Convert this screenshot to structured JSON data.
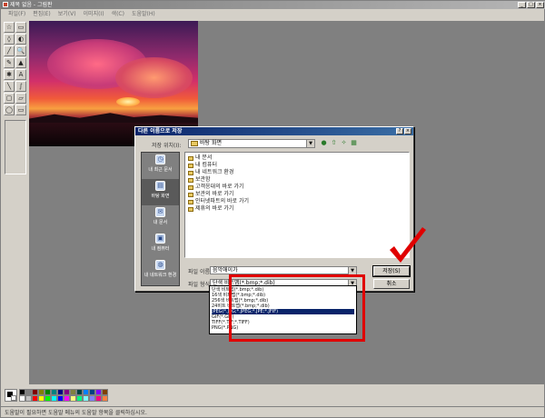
{
  "window": {
    "title": "제목 없음 - 그림판",
    "buttons": [
      "_",
      "□",
      "×"
    ]
  },
  "menu": [
    "파일(F)",
    "편집(E)",
    "보기(V)",
    "이미지(I)",
    "색(C)",
    "도움말(H)"
  ],
  "toolbox": {
    "tools": [
      "☆",
      "▭",
      "◊",
      "◐",
      "╱",
      "🔍",
      "✎",
      "▲",
      "✱",
      "A",
      "╲",
      "∫",
      "▢",
      "▱",
      "◯",
      "▭"
    ]
  },
  "palette": {
    "colors": [
      "#000000",
      "#808080",
      "#800000",
      "#808000",
      "#008000",
      "#008080",
      "#000080",
      "#800080",
      "#808040",
      "#004040",
      "#0080ff",
      "#004080",
      "#8000ff",
      "#804000",
      "#ffffff",
      "#c0c0c0",
      "#ff0000",
      "#ffff00",
      "#00ff00",
      "#00ffff",
      "#0000ff",
      "#ff00ff",
      "#ffff80",
      "#00ff80",
      "#80ffff",
      "#8080ff",
      "#ff0080",
      "#ff8040"
    ]
  },
  "status": "도움말이 필요하면 도움말 메뉴의 도움말 항목을 클릭하십시오.",
  "dialog": {
    "title": "다른 이름으로 저장",
    "close": "×",
    "help": "?",
    "look_in_label": "저장 위치(I):",
    "look_in_value": "바탕 화면",
    "nav_icons": [
      "●",
      "⇧",
      "✧",
      "▦"
    ],
    "places": [
      "내 최근 문서",
      "바탕 화면",
      "내 문서",
      "내 컴퓨터",
      "내 네트워크 환경"
    ],
    "places_icons": [
      "◷",
      "▤",
      "✉",
      "▣",
      "◍"
    ],
    "files": [
      "내 문서",
      "내 컴퓨터",
      "내 네트워크 환경",
      "보관함",
      "고객응대의 바로 가기",
      "보관의 바로 가기",
      "인터넷파트의 바로 가기",
      "제휴의 바로 가기"
    ],
    "filename_label": "파일 이름(N):",
    "filename_value": "음악애이가",
    "filetype_label": "파일 형식(T):",
    "filetype_value": "단색 비트맵(*.bmp;*.dib)",
    "save_button": "저장(S)",
    "cancel_button": "취소",
    "filetype_options": [
      "단색 비트맵(*.bmp;*.dib)",
      "16색 비트맵(*.bmp;*.dib)",
      "256색 비트맵(*.bmp;*.dib)",
      "24비트 비트맵(*.bmp;*.dib)",
      "JPEG(*.JPG;*.JPEG;*.JPE;*.JFIF)",
      "GIF(*.GIF)",
      "TIFF(*.TIF;*.TIFF)",
      "PNG(*.PNG)"
    ],
    "selected_option_index": 4
  },
  "annotation": {
    "highlight_color": "#e00000"
  }
}
